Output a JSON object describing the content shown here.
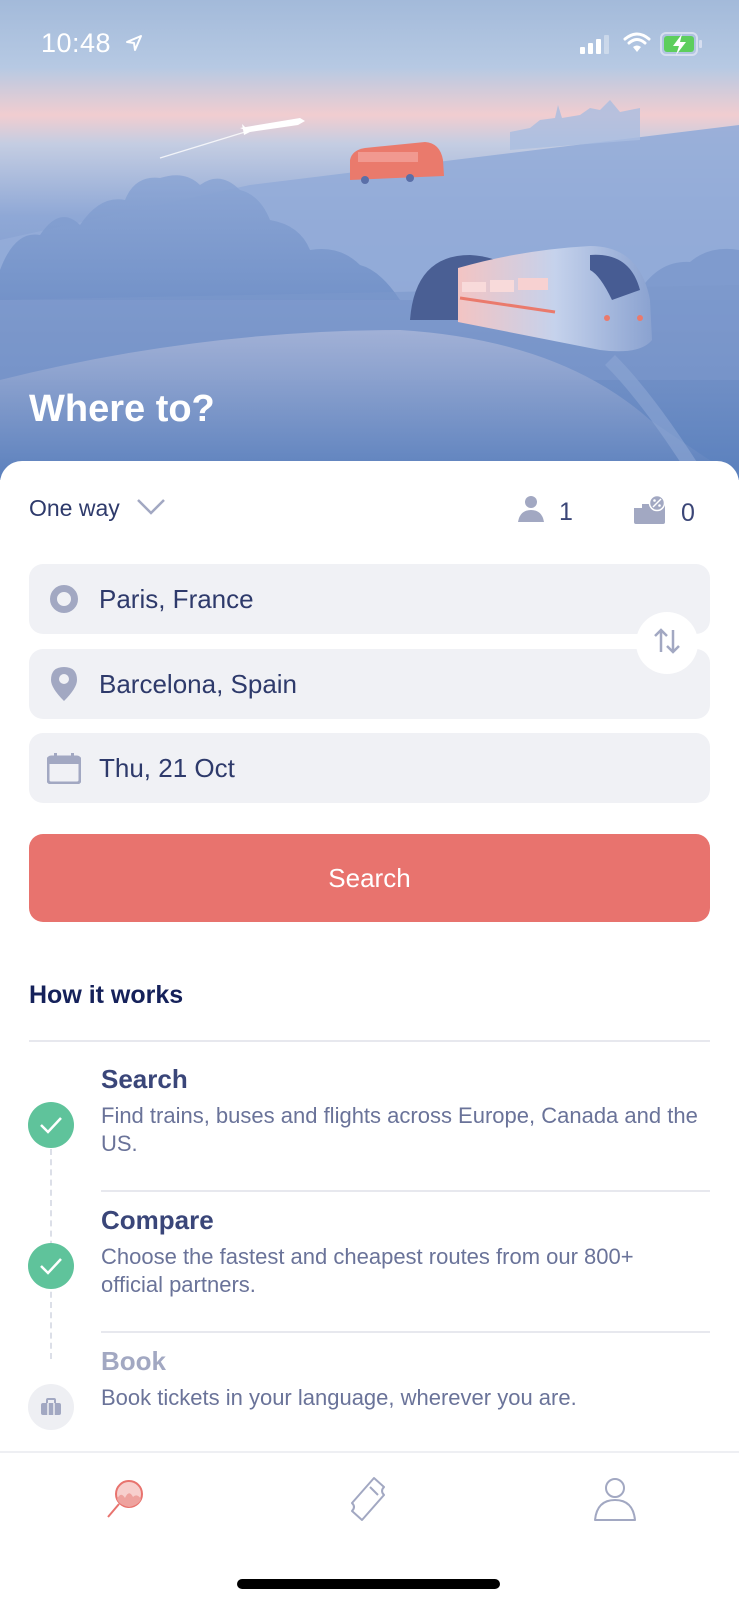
{
  "status_bar": {
    "time": "10:48",
    "icons": [
      "location-arrow-icon",
      "signal-icon",
      "wifi-icon",
      "battery-charging-icon"
    ]
  },
  "hero": {
    "title": "Where to?",
    "illustration": "train-bus-plane-landscape"
  },
  "trip_options": {
    "trip_type": "One way",
    "passengers": "1",
    "discount_cards": "0"
  },
  "search_form": {
    "from": "Paris, France",
    "to": "Barcelona, Spain",
    "date": "Thu, 21 Oct",
    "search_label": "Search"
  },
  "how_it_works": {
    "title": "How it works",
    "steps": [
      {
        "title": "Search",
        "description": "Find trains, buses and flights across Europe, Canada and the US.",
        "status": "done"
      },
      {
        "title": "Compare",
        "description": "Choose the fastest and cheapest routes from our 800+ official partners.",
        "status": "done"
      },
      {
        "title": "Book",
        "description": "Book tickets in your language, wherever you are.",
        "status": "pending"
      }
    ]
  },
  "tab_bar": {
    "tabs": [
      {
        "name": "search",
        "icon": "search-icon",
        "active": true
      },
      {
        "name": "tickets",
        "icon": "ticket-icon",
        "active": false
      },
      {
        "name": "account",
        "icon": "user-icon",
        "active": false
      }
    ]
  },
  "colors": {
    "accent": "#e8736e",
    "success": "#5fc39b",
    "text_primary": "#2e3a6b",
    "field_bg": "#f0f1f5"
  }
}
